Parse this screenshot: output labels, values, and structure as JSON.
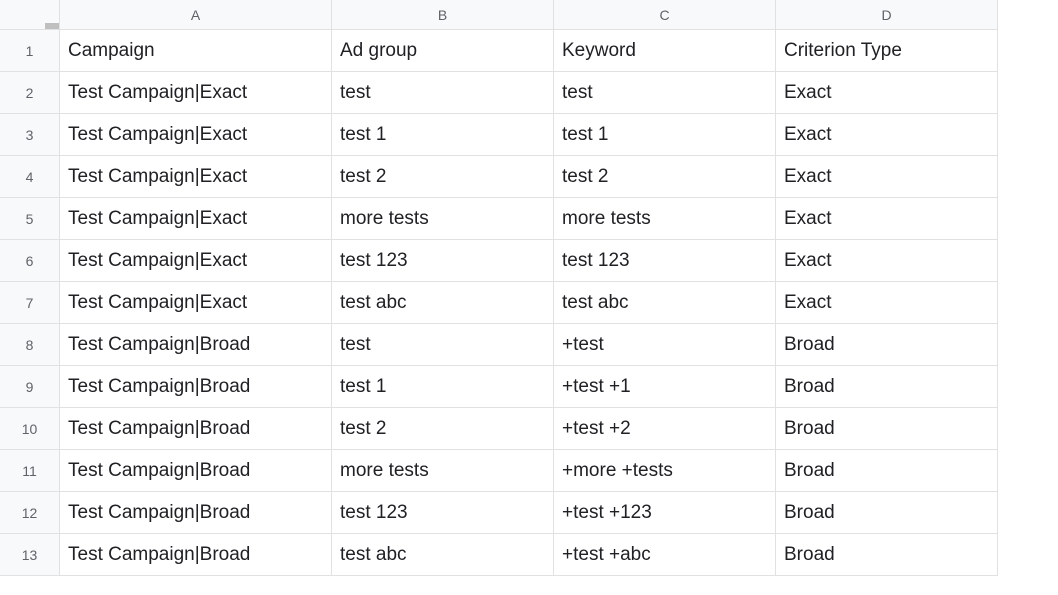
{
  "columns": [
    "A",
    "B",
    "C",
    "D"
  ],
  "row_numbers": [
    "1",
    "2",
    "3",
    "4",
    "5",
    "6",
    "7",
    "8",
    "9",
    "10",
    "11",
    "12",
    "13"
  ],
  "chart_data": {
    "type": "table",
    "headers": [
      "Campaign",
      "Ad group",
      "Keyword",
      "Criterion Type"
    ],
    "rows": [
      [
        "Test Campaign|Exact",
        "test",
        "test",
        "Exact"
      ],
      [
        "Test Campaign|Exact",
        "test 1",
        "test 1",
        "Exact"
      ],
      [
        "Test Campaign|Exact",
        "test 2",
        "test 2",
        "Exact"
      ],
      [
        "Test Campaign|Exact",
        "more tests",
        "more tests",
        "Exact"
      ],
      [
        "Test Campaign|Exact",
        "test 123",
        "test 123",
        "Exact"
      ],
      [
        "Test Campaign|Exact",
        "test abc",
        "test abc",
        "Exact"
      ],
      [
        "Test Campaign|Broad",
        "test",
        "+test",
        "Broad"
      ],
      [
        "Test Campaign|Broad",
        "test 1",
        "+test +1",
        "Broad"
      ],
      [
        "Test Campaign|Broad",
        "test 2",
        "+test +2",
        "Broad"
      ],
      [
        "Test Campaign|Broad",
        "more tests",
        "+more +tests",
        "Broad"
      ],
      [
        "Test Campaign|Broad",
        "test 123",
        "+test +123",
        "Broad"
      ],
      [
        "Test Campaign|Broad",
        "test abc",
        "+test +abc",
        "Broad"
      ]
    ]
  }
}
